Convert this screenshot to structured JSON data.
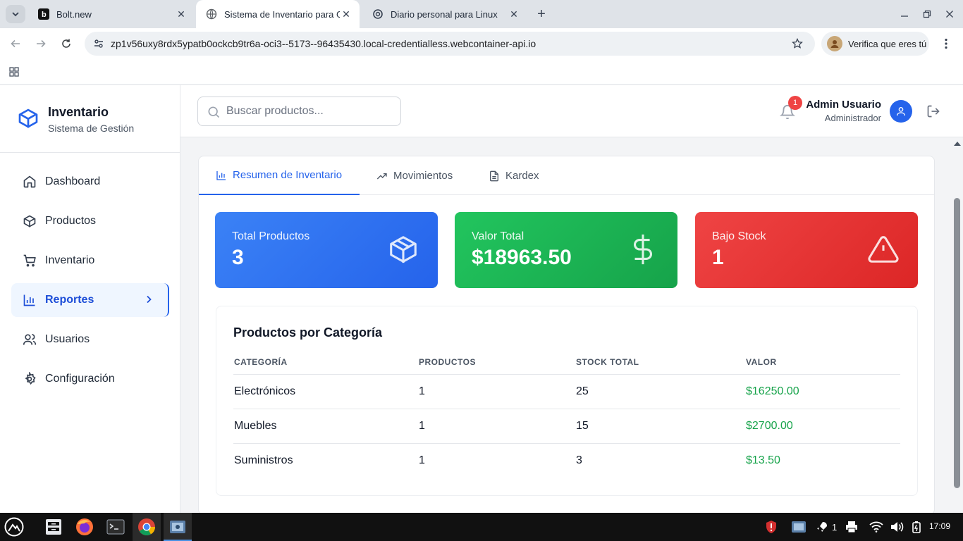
{
  "browser": {
    "tabs": [
      {
        "title": "Bolt.new",
        "favicon": "bolt-favicon",
        "active": false
      },
      {
        "title": "Sistema de Inventario para Ge",
        "favicon": "globe-favicon",
        "active": true
      },
      {
        "title": "Diario personal para Linux",
        "favicon": "openai-favicon",
        "active": false
      }
    ],
    "url": "zp1v56uxy8rdx5ypatb0ockcb9tr6a-oci3--5173--96435430.local-credentialless.webcontainer-api.io",
    "profile_chip": "Verifica que eres tú"
  },
  "sidebar": {
    "brand_title": "Inventario",
    "brand_subtitle": "Sistema de Gestión",
    "items": [
      {
        "label": "Dashboard",
        "icon": "home-icon"
      },
      {
        "label": "Productos",
        "icon": "package-icon"
      },
      {
        "label": "Inventario",
        "icon": "cart-icon"
      },
      {
        "label": "Reportes",
        "icon": "bar-chart-icon",
        "active": true
      },
      {
        "label": "Usuarios",
        "icon": "users-icon"
      },
      {
        "label": "Configuración",
        "icon": "settings-icon"
      }
    ]
  },
  "header": {
    "search_placeholder": "Buscar productos...",
    "notification_count": "1",
    "user_name": "Admin Usuario",
    "user_role": "Administrador"
  },
  "reports": {
    "tabs": [
      {
        "label": "Resumen de Inventario",
        "icon": "bar-chart-icon",
        "active": true
      },
      {
        "label": "Movimientos",
        "icon": "trending-up-icon"
      },
      {
        "label": "Kardex",
        "icon": "file-text-icon"
      }
    ],
    "stats": [
      {
        "label": "Total Productos",
        "value": "3",
        "icon": "package-icon",
        "color": "#2563eb"
      },
      {
        "label": "Valor Total",
        "value": "$18963.50",
        "icon": "dollar-icon",
        "color": "#16a34a"
      },
      {
        "label": "Bajo Stock",
        "value": "1",
        "icon": "alert-triangle-icon",
        "color": "#dc2626"
      }
    ],
    "category_title": "Productos por Categoría",
    "columns": [
      "CATEGORÍA",
      "PRODUCTOS",
      "STOCK TOTAL",
      "VALOR"
    ],
    "rows": [
      {
        "category": "Electrónicos",
        "products": "1",
        "stock": "25",
        "value": "$16250.00"
      },
      {
        "category": "Muebles",
        "products": "1",
        "stock": "15",
        "value": "$2700.00"
      },
      {
        "category": "Suministros",
        "products": "1",
        "stock": "3",
        "value": "$13.50"
      }
    ]
  },
  "taskbar": {
    "notification_count": "1",
    "clock": "17:09"
  }
}
